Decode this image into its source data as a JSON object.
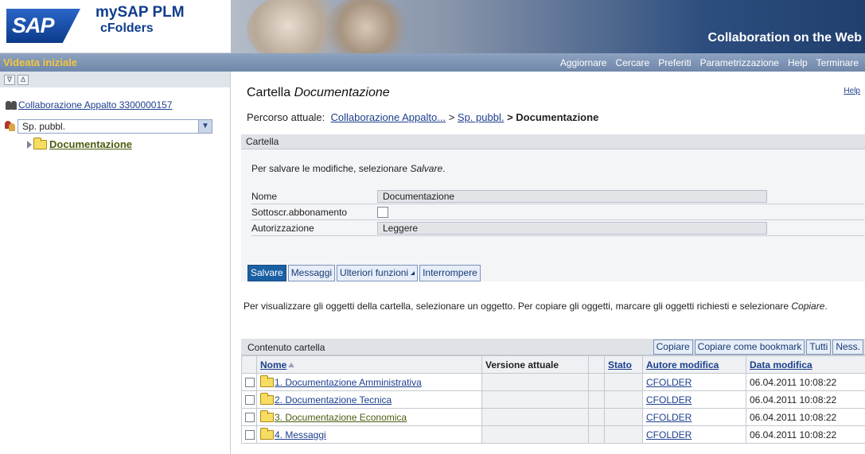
{
  "header": {
    "logo_text": "SAP",
    "product_line1": "mySAP PLM",
    "product_line2": "cFolders",
    "tagline": "Collaboration on the Web"
  },
  "menubar": {
    "app_title": "Videata iniziale",
    "items": [
      "Aggiornare",
      "Cercare",
      "Preferiti",
      "Parametrizzazione",
      "Help",
      "Terminare"
    ]
  },
  "sidebar": {
    "toolbar_icons": [
      "collapse-icon",
      "expand-icon"
    ],
    "root_link": "Collaborazione Appalto 3300000157",
    "space_select": "Sp. pubbl.",
    "folder": "Documentazione"
  },
  "main": {
    "title_prefix": "Cartella",
    "title_name": "Documentazione",
    "help": "Help",
    "path_label": "Percorso attuale:",
    "path_crumb1": "Collaborazione Appalto...",
    "path_sep": ">",
    "path_crumb2": "Sp. pubbl.",
    "path_current": "> Documentazione",
    "section_title": "Cartella",
    "instr1_text": "Per salvare le modifiche, selezionare ",
    "instr1_em": "Salvare",
    "instr1_end": ".",
    "fields": {
      "nome_label": "Nome",
      "nome_value": "Documentazione",
      "sottoscr_label": "Sottoscr.abbonamento",
      "autorizz_label": "Autorizzazione",
      "autorizz_value": "Leggere"
    },
    "buttons": {
      "salvare": "Salvare",
      "messaggi": "Messaggi",
      "ulteriori": "Ulteriori funzioni",
      "interrompere": "Interrompere"
    },
    "instr2_text": "Per visualizzare gli oggetti della cartella, selezionare un oggetto. Per copiare gli oggetti, marcare gli oggetti richiesti e selezionare ",
    "instr2_em": "Copiare",
    "instr2_end": "."
  },
  "content": {
    "title": "Contenuto cartella",
    "buttons": {
      "copiare": "Copiare",
      "copiare_bookmark": "Copiare come bookmark",
      "tutti": "Tutti",
      "ness": "Ness."
    },
    "columns": {
      "nome": "Nome",
      "versione": "Versione attuale",
      "stato": "Stato",
      "autore": "Autore modifica",
      "data": "Data modifica"
    },
    "rows": [
      {
        "name": "1. Documentazione Amministrativa",
        "author": "CFOLDER",
        "date": "06.04.2011 10:08:22"
      },
      {
        "name": "2. Documentazione Tecnica",
        "author": "CFOLDER",
        "date": "06.04.2011 10:08:22"
      },
      {
        "name": "3. Documentazione Economica",
        "author": "CFOLDER",
        "date": "06.04.2011 10:08:22"
      },
      {
        "name": "4. Messaggi",
        "author": "CFOLDER",
        "date": "06.04.2011 10:08:22"
      }
    ]
  },
  "colors": {
    "menubar": "#7d93b5",
    "app_title": "#f3c63c",
    "link": "#1c3f8e",
    "primary_button": "#1a5fa3"
  }
}
